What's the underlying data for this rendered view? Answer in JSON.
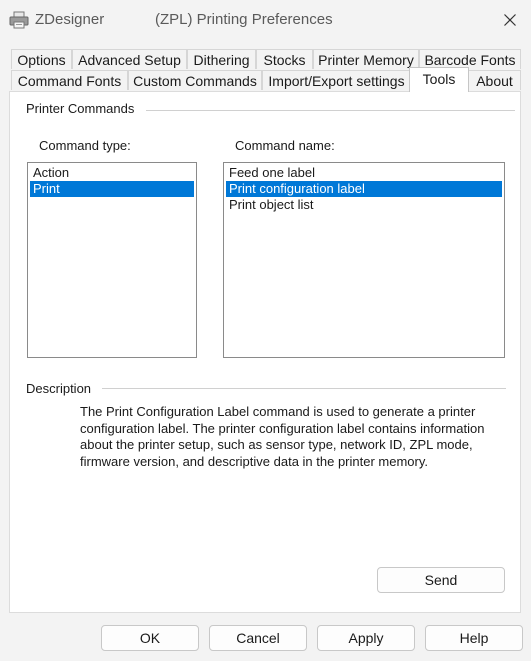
{
  "window": {
    "app_name": "ZDesigner",
    "title": "(ZPL) Printing Preferences"
  },
  "tabs_row1": [
    {
      "label": "Options"
    },
    {
      "label": "Advanced Setup"
    },
    {
      "label": "Dithering"
    },
    {
      "label": "Stocks"
    },
    {
      "label": "Printer Memory"
    },
    {
      "label": "Barcode Fonts"
    }
  ],
  "tabs_row2": [
    {
      "label": "Command Fonts"
    },
    {
      "label": "Custom Commands"
    },
    {
      "label": "Import/Export settings"
    },
    {
      "label": "Tools",
      "active": true
    },
    {
      "label": "About"
    }
  ],
  "printer_commands": {
    "group_title": "Printer Commands",
    "command_type_label": "Command type:",
    "command_type_items": [
      "Action",
      "Print"
    ],
    "command_type_selected": "Print",
    "command_name_label": "Command name:",
    "command_name_items": [
      "Feed one label",
      "Print configuration label",
      "Print object list"
    ],
    "command_name_selected": "Print configuration label"
  },
  "description": {
    "group_title": "Description",
    "text": "The Print Configuration Label command is used to generate a printer configuration label. The printer configuration label contains information about the printer setup, such as sensor type, network ID, ZPL mode, firmware version, and descriptive data in the printer memory."
  },
  "buttons": {
    "send": "Send",
    "ok": "OK",
    "cancel": "Cancel",
    "apply": "Apply",
    "help": "Help"
  },
  "colors": {
    "selection": "#0078d7",
    "window_bg": "#f3f3f3"
  }
}
